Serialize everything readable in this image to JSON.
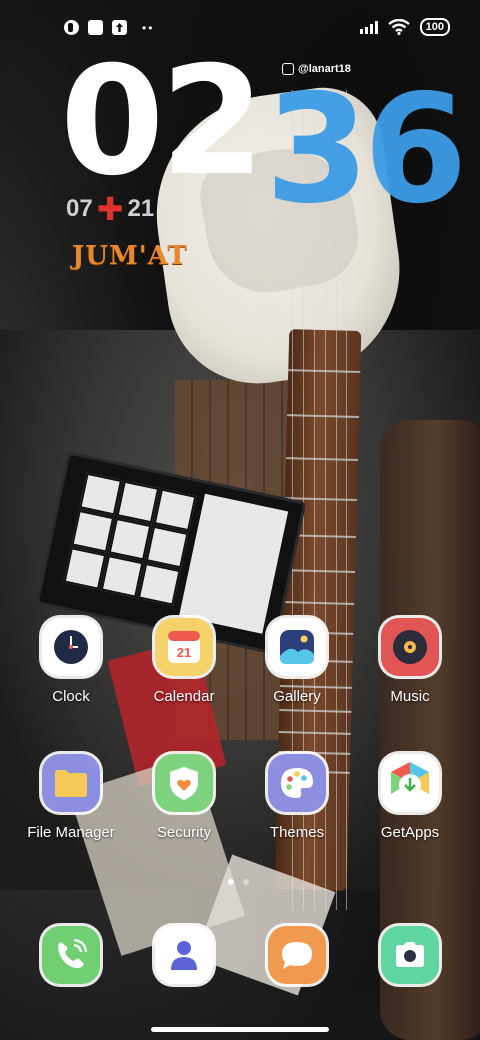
{
  "status": {
    "battery": "100"
  },
  "widget": {
    "hour": "02",
    "minute": "36",
    "handle": "@lanart18",
    "day": "07",
    "month": "21",
    "weekday": "JUM'AT"
  },
  "apps": [
    {
      "label": "Clock",
      "icon": "clock-icon",
      "bg": "#ffffff"
    },
    {
      "label": "Calendar",
      "icon": "calendar-icon",
      "bg": "#f5d26a",
      "badge": "21"
    },
    {
      "label": "Gallery",
      "icon": "gallery-icon",
      "bg": "#ffffff"
    },
    {
      "label": "Music",
      "icon": "music-icon",
      "bg": "#e25555"
    },
    {
      "label": "File Manager",
      "icon": "folder-icon",
      "bg": "#8c8ee0"
    },
    {
      "label": "Security",
      "icon": "shield-heart-icon",
      "bg": "#7ed47e"
    },
    {
      "label": "Themes",
      "icon": "palette-icon",
      "bg": "#8c8ee0"
    },
    {
      "label": "GetApps",
      "icon": "getapps-icon",
      "bg": "#ffffff"
    }
  ],
  "dock": [
    {
      "icon": "phone-icon",
      "bg": "#6fcf72"
    },
    {
      "icon": "contacts-icon",
      "bg": "#ffffff"
    },
    {
      "icon": "messages-icon",
      "bg": "#f09a4f"
    },
    {
      "icon": "camera-icon",
      "bg": "#5fd6a0"
    }
  ],
  "pages": {
    "current": 1,
    "total": 2
  }
}
